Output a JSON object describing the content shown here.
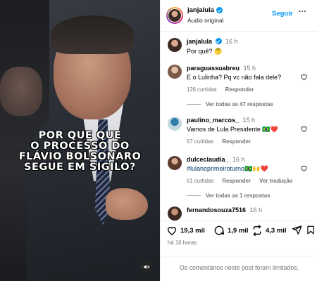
{
  "media": {
    "overlay_lines": [
      "POR QUE QUE",
      "O PROCESSO DO",
      "FLÁVIO BOLSONARO",
      "SEGUE EM SIGILO?"
    ],
    "mute_icon": "speaker-muted-icon"
  },
  "header": {
    "username": "janjalula",
    "subtitle": "Áudio original",
    "follow_label": "Seguir",
    "more_label": "···"
  },
  "caption": {
    "username": "janjalula",
    "time": "16 h",
    "text": "Por quê? 🤔"
  },
  "comments": [
    {
      "username": "paraguassuabreu",
      "time": "15 h",
      "text": "E o Lulinha? Pq vc não fala dele?",
      "likes": "126 curtidas",
      "reply_label": "Responder",
      "view_replies": "Ver todas as 47 respostas"
    },
    {
      "username": "paulino_marcos_",
      "time": "15 h",
      "text": "Vamos de Lula Presidente 🇧🇷❤️",
      "likes": "67 curtidas",
      "reply_label": "Responder"
    },
    {
      "username": "dulceclaudia_",
      "time": "16 h",
      "text": "#lulanoprimeiroturno🇧🇷🙌❤️",
      "likes": "61 curtidas",
      "reply_label": "Responder",
      "translate_label": "Ver tradução",
      "view_replies": "Ver todas as 1 respostas"
    },
    {
      "username": "fernandosouza7516",
      "time": "16 h"
    }
  ],
  "actions": {
    "likes": "19,3 mil",
    "comments": "1,9 mil",
    "reposts": "4,3 mil",
    "time_ago": "há 16 horas"
  },
  "footer": {
    "limited_text": "Os comentários neste post foram limitados."
  },
  "colors": {
    "accent_blue": "#0095f6",
    "muted_text": "#737373",
    "hashtag": "#00376b"
  }
}
